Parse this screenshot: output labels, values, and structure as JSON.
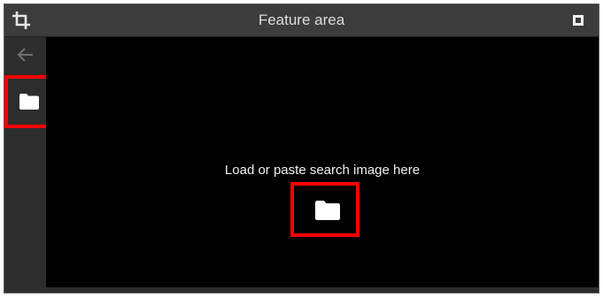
{
  "window": {
    "title": "Feature area"
  },
  "icons": {
    "crop": "crop-icon",
    "maximize": "maximize-icon",
    "back": "arrow-left-icon",
    "folder": "folder-icon"
  },
  "content": {
    "prompt": "Load or paste search image here"
  },
  "colors": {
    "highlight": "#ff0000",
    "titlebar_bg": "#3c3c3c",
    "content_bg": "#000000",
    "sidebar_bg": "#2d2d2d"
  }
}
